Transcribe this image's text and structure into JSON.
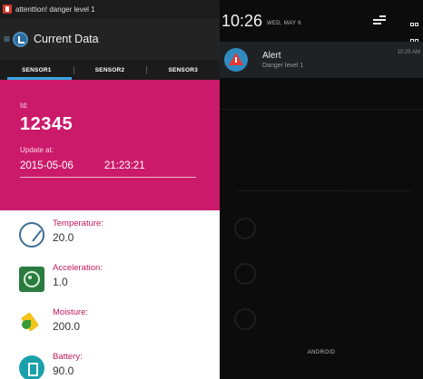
{
  "left_screen": {
    "statusbar": {
      "notification_text": "attenttion! danger level 1"
    },
    "actionbar": {
      "title": "Current Data"
    },
    "tabs": [
      {
        "label": "SENSOR1",
        "active": true
      },
      {
        "label": "SENSOR2",
        "active": false
      },
      {
        "label": "SENSOR3",
        "active": false
      }
    ],
    "panel": {
      "id_label": "Id:",
      "id_value": "12345",
      "update_label": "Update at:",
      "update_date": "2015-05-06",
      "update_time": "21:23:21",
      "background_color": "#cc1a6a"
    },
    "readings": [
      {
        "icon": "gauge-icon",
        "label": "Temperature:",
        "value": "20.0"
      },
      {
        "icon": "vibration-icon",
        "label": "Acceleration:",
        "value": "1.0"
      },
      {
        "icon": "watering-icon",
        "label": "Moisture:",
        "value": "200.0"
      },
      {
        "icon": "battery-icon",
        "label": "Battery:",
        "value": "90.0"
      }
    ]
  },
  "right_screen": {
    "clock": "10:26",
    "date": "WED, MAY 6",
    "notification": {
      "icon": "alert-triangle-icon",
      "title": "Alert",
      "text": "Danger level 1",
      "time": "10:25 AM"
    },
    "carrier": "ANDROID"
  }
}
